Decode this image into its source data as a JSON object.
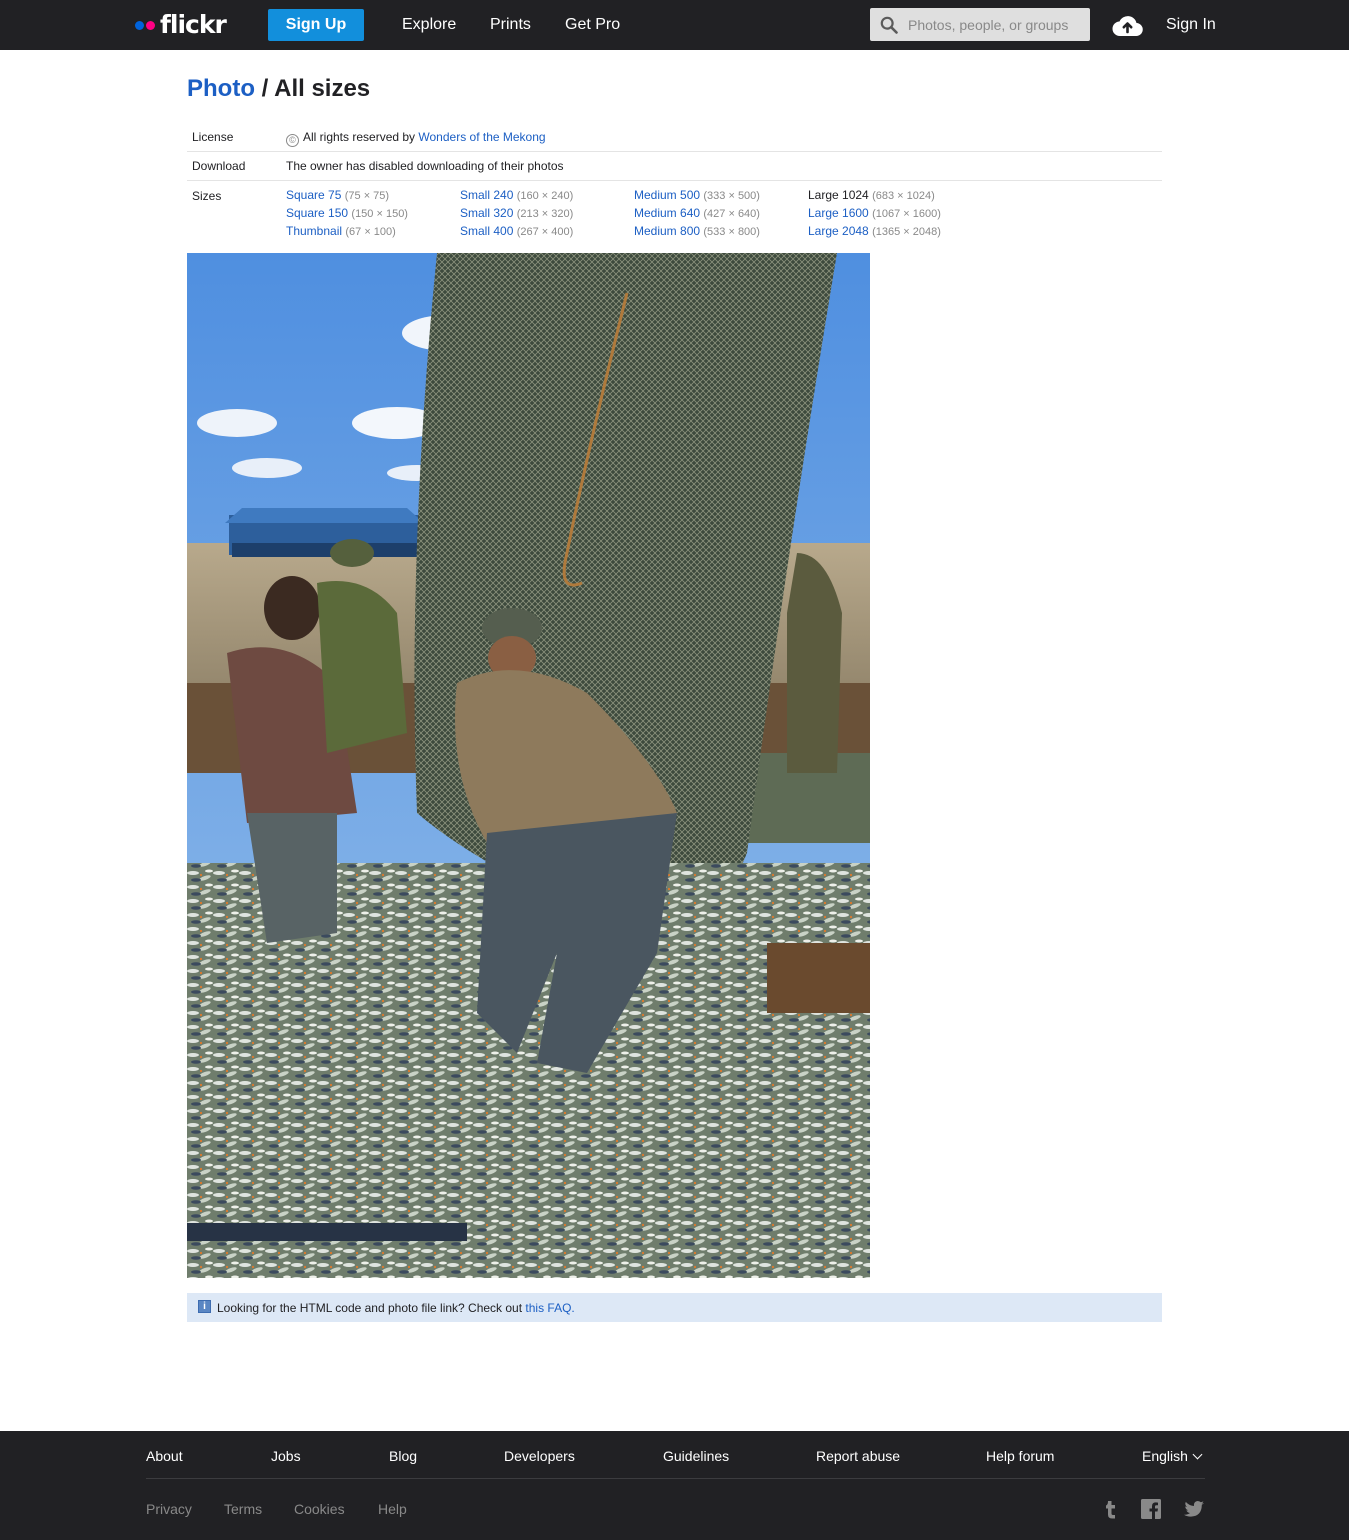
{
  "header": {
    "logo_text": "flickr",
    "signup_label": "Sign Up",
    "nav": [
      "Explore",
      "Prints",
      "Get Pro"
    ],
    "search_placeholder": "Photos, people, or groups",
    "signin_label": "Sign In",
    "upload_icon": "cloud-upload-icon"
  },
  "title": {
    "crumb": "Photo",
    "separator": " / ",
    "current": "All sizes"
  },
  "info": {
    "license_label": "License",
    "license_text": "All rights reserved by ",
    "license_owner": "Wonders of the Mekong",
    "download_label": "Download",
    "download_text": "The owner has disabled downloading of their photos",
    "sizes_label": "Sizes",
    "size_columns": [
      [
        {
          "name": "Square 75",
          "dims": "(75 × 75)"
        },
        {
          "name": "Square 150",
          "dims": "(150 × 150)"
        },
        {
          "name": "Thumbnail",
          "dims": "(67 × 100)"
        }
      ],
      [
        {
          "name": "Small 240",
          "dims": "(160 × 240)"
        },
        {
          "name": "Small 320",
          "dims": "(213 × 320)"
        },
        {
          "name": "Small 400",
          "dims": "(267 × 400)"
        }
      ],
      [
        {
          "name": "Medium 500",
          "dims": "(333 × 500)"
        },
        {
          "name": "Medium 640",
          "dims": "(427 × 640)"
        },
        {
          "name": "Medium 800",
          "dims": "(533 × 800)"
        }
      ],
      [
        {
          "name": "Large 1024",
          "dims": "(683 × 1024)"
        },
        {
          "name": "Large 1600",
          "dims": "(1067 × 1600)"
        },
        {
          "name": "Large 2048",
          "dims": "(1365 × 2048)"
        }
      ]
    ],
    "current_size": "Large 1024"
  },
  "faq": {
    "text": "Looking for the HTML code and photo file link? Check out ",
    "link": "this FAQ."
  },
  "footer": {
    "links": [
      "About",
      "Jobs",
      "Blog",
      "Developers",
      "Guidelines",
      "Report abuse",
      "Help forum",
      "English"
    ],
    "sub_links": [
      "Privacy",
      "Terms",
      "Cookies",
      "Help"
    ],
    "social_icons": [
      "tumblr-icon",
      "facebook-icon",
      "twitter-icon"
    ]
  },
  "colors": {
    "header_bg": "#212124",
    "brand_blue": "#0063dc",
    "brand_pink": "#ff0084",
    "signup_bg": "#128fdc",
    "link": "#1c5fc4",
    "faq_bg": "#dde8f6"
  }
}
